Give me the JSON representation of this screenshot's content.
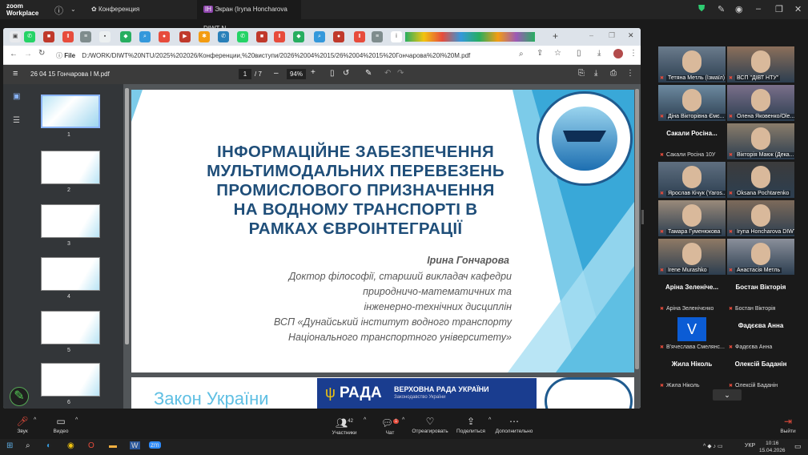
{
  "zoom": {
    "logo_line1": "zoom",
    "logo_line2": "Workplace",
    "tab_conf": "Конференция",
    "tab_screen": "Экран (Iryna Honcharova DIWT N",
    "leave": "Выйти",
    "controls": [
      {
        "label": "Звук",
        "icon": "mic-muted-icon"
      },
      {
        "label": "Видео",
        "icon": "camera-icon"
      },
      {
        "label": "Участники",
        "count": "42",
        "icon": "participants-icon"
      },
      {
        "label": "Чат",
        "badge": "1",
        "icon": "chat-icon"
      },
      {
        "label": "Отреагировать",
        "icon": "react-icon"
      },
      {
        "label": "Поделиться",
        "icon": "share-icon"
      },
      {
        "label": "Дополнительно",
        "icon": "more-icon"
      }
    ]
  },
  "browser": {
    "url_prefix": "File",
    "url": "D:/WORK/DIWT%20NTU/2025%202026/Конференции,%20виступи/2026%2004%2015/26%2004%2015%20Гончарова%20I%20M.pdf",
    "pdf_title": "26 04 15 Гончарова І М.pdf",
    "page_current": "1",
    "page_total": "/ 7",
    "zoom": "94%"
  },
  "thumbnails": [
    "1",
    "2",
    "3",
    "4",
    "5",
    "6"
  ],
  "slide": {
    "title_lines": [
      "ІНФОРМАЦІЙНЕ ЗАБЕЗПЕЧЕННЯ",
      "МУЛЬТИМОДАЛЬНИХ ПЕРЕВЕЗЕНЬ",
      "ПРОМИСЛОВОГО ПРИЗНАЧЕННЯ",
      "НА ВОДНОМУ ТРАНСПОРТІ В",
      "РАМКАХ ЄВРОІНТЕГРАЦІЇ"
    ],
    "author_name": "Ірина Гончарова",
    "author_lines": [
      "Доктор філософії, старший викладач кафедри",
      "природничо-математичних та",
      "інженерно-технічних дисциплін",
      "ВСП «Дунайський інститут водного транспорту",
      "Національного транспортного університету»"
    ],
    "next_slide_title": "Закон України",
    "rada_title": "ВЕРХОВНА РАДА УКРАЇНИ",
    "rada_sub": "Законодавство України",
    "rada_word": "РАДА"
  },
  "participants": [
    {
      "name": "Тетяна Метль (Ізмаїл)",
      "type": "video"
    },
    {
      "name": "ВСП \"ДІВТ НТУ\"",
      "type": "video"
    },
    {
      "name": "Діна Вікторівна Ємє...",
      "type": "video"
    },
    {
      "name": "Олена Яковенко/Ole...",
      "type": "video"
    },
    {
      "name": "Сакали Росіна 10У",
      "type": "name",
      "big": "Сакали Росіна..."
    },
    {
      "name": "Вікторія Маюк (Дека...",
      "type": "video"
    },
    {
      "name": "Ярослав Кічук (Yaros...",
      "type": "video"
    },
    {
      "name": "Oksana Pochtarenko",
      "type": "video"
    },
    {
      "name": "Тамара Гуменюкова",
      "type": "video"
    },
    {
      "name": "Iryna Honcharova DIWT...",
      "type": "video"
    },
    {
      "name": "Irene Murashko",
      "type": "video"
    },
    {
      "name": "Анастасія Метль",
      "type": "video"
    },
    {
      "name": "Аріна Зеленічєнко",
      "type": "name",
      "big": "Аріна Зеленіче..."
    },
    {
      "name": "Бостан Вікторія",
      "type": "name",
      "big": "Бостан Вікторія"
    },
    {
      "name": "В'ячеслава Смелянс...",
      "type": "avatar",
      "big": "V"
    },
    {
      "name": "Фадєєва Анна",
      "type": "name",
      "big": "Фадєєва Анна"
    },
    {
      "name": "Жила Ніколь",
      "type": "name",
      "big": "Жила Ніколь"
    },
    {
      "name": "Олексій Баданін",
      "type": "name",
      "big": "Олексій Баданін"
    }
  ],
  "taskbar": {
    "time": "10:16",
    "date": "15.04.2026",
    "lang": "УКР"
  }
}
